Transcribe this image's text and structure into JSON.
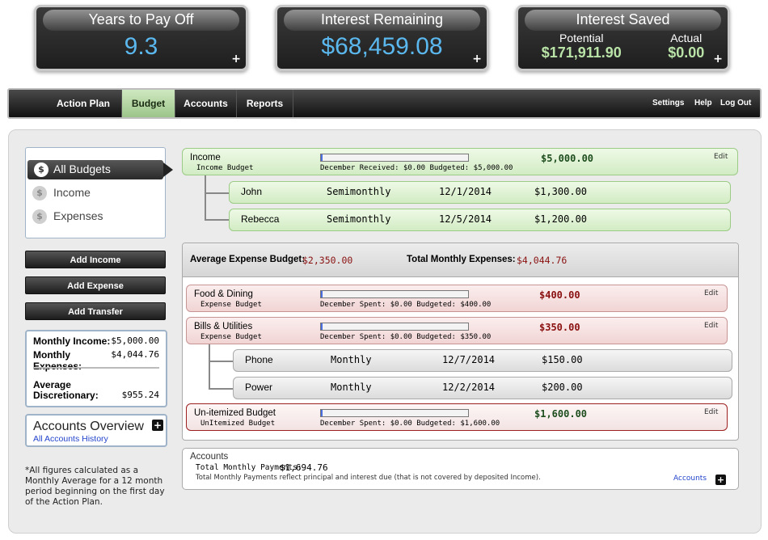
{
  "tiles": {
    "years": {
      "title": "Years to Pay Off",
      "value": "9.3",
      "plus": "+"
    },
    "interest_remaining": {
      "title": "Interest Remaining",
      "value": "$68,459.08",
      "plus": "+"
    },
    "interest_saved": {
      "title": "Interest Saved",
      "potential_label": "Potential",
      "potential_value": "$171,911.90",
      "actual_label": "Actual",
      "actual_value": "$0.00",
      "plus": "+"
    }
  },
  "nav": {
    "items": [
      "Action Plan",
      "Budget",
      "Accounts",
      "Reports"
    ],
    "active": "Budget",
    "right": [
      "Settings",
      "Help",
      "Log Out"
    ]
  },
  "sidebar": {
    "items": [
      {
        "label": "All Budgets",
        "icon": "dollar-coin-icon"
      },
      {
        "label": "Income",
        "icon": "income-coin-icon"
      },
      {
        "label": "Expenses",
        "icon": "expense-coin-icon"
      }
    ],
    "buttons": [
      "Add Income",
      "Add Expense",
      "Add Transfer"
    ]
  },
  "summary": {
    "monthly_income_label": "Monthly Income:",
    "monthly_income": "$5,000.00",
    "monthly_expenses_label": "Monthly Expenses:",
    "monthly_expenses": "$4,044.76",
    "avg_label_1": "Average",
    "avg_label_2": "Discretionary:",
    "avg_value": "$955.24"
  },
  "accounts_overview": {
    "title": "Accounts Overview",
    "link": "All Accounts History",
    "plus": "+"
  },
  "footnote": "*All figures calculated as a Monthly Average for a 12 month period beginning on the first day of the Action Plan.",
  "income": {
    "title": "Income",
    "subtitle": "Income Budget",
    "progress": 0.0,
    "detail": "December Received: $0.00 Budgeted: $5,000.00",
    "amount": "$5,000.00",
    "edit": "Edit",
    "rows": [
      {
        "name": "John",
        "freq": "Semimonthly",
        "date": "12/1/2014",
        "amount": "$1,300.00"
      },
      {
        "name": "Rebecca",
        "freq": "Semimonthly",
        "date": "12/5/2014",
        "amount": "$1,200.00"
      }
    ]
  },
  "expense_header": {
    "avg_label": "Average Expense Budget:",
    "avg_value": "$2,350.00",
    "total_label": "Total Monthly Expenses:",
    "total_value": "$4,044.76"
  },
  "expenses": [
    {
      "title": "Food & Dining",
      "subtitle": "Expense Budget",
      "progress": 0.0,
      "detail": "December Spent: $0.00 Budgeted: $400.00",
      "amount": "$400.00",
      "edit": "Edit"
    },
    {
      "title": "Bills & Utilities",
      "subtitle": "Expense Budget",
      "progress": 0.0,
      "detail": "December Spent: $0.00 Budgeted: $350.00",
      "amount": "$350.00",
      "edit": "Edit"
    },
    {
      "title": "Un-itemized Budget",
      "subtitle": "UnItemized Budget",
      "progress": 0.0,
      "detail": "December Spent: $0.00 Budgeted: $1,600.00",
      "amount": "$1,600.00",
      "edit": "Edit"
    }
  ],
  "bills_rows": [
    {
      "name": "Phone",
      "freq": "Monthly",
      "date": "12/7/2014",
      "amount": "$150.00"
    },
    {
      "name": "Power",
      "freq": "Monthly",
      "date": "12/2/2014",
      "amount": "$200.00"
    }
  ],
  "accounts": {
    "title": "Accounts",
    "total_label": "Total Monthly Payments:",
    "total_value": "$1,694.76",
    "note": "Total Monthly Payments reflect principal and interest due (that is not covered by deposited Income).",
    "link": "Accounts",
    "plus": "+"
  }
}
